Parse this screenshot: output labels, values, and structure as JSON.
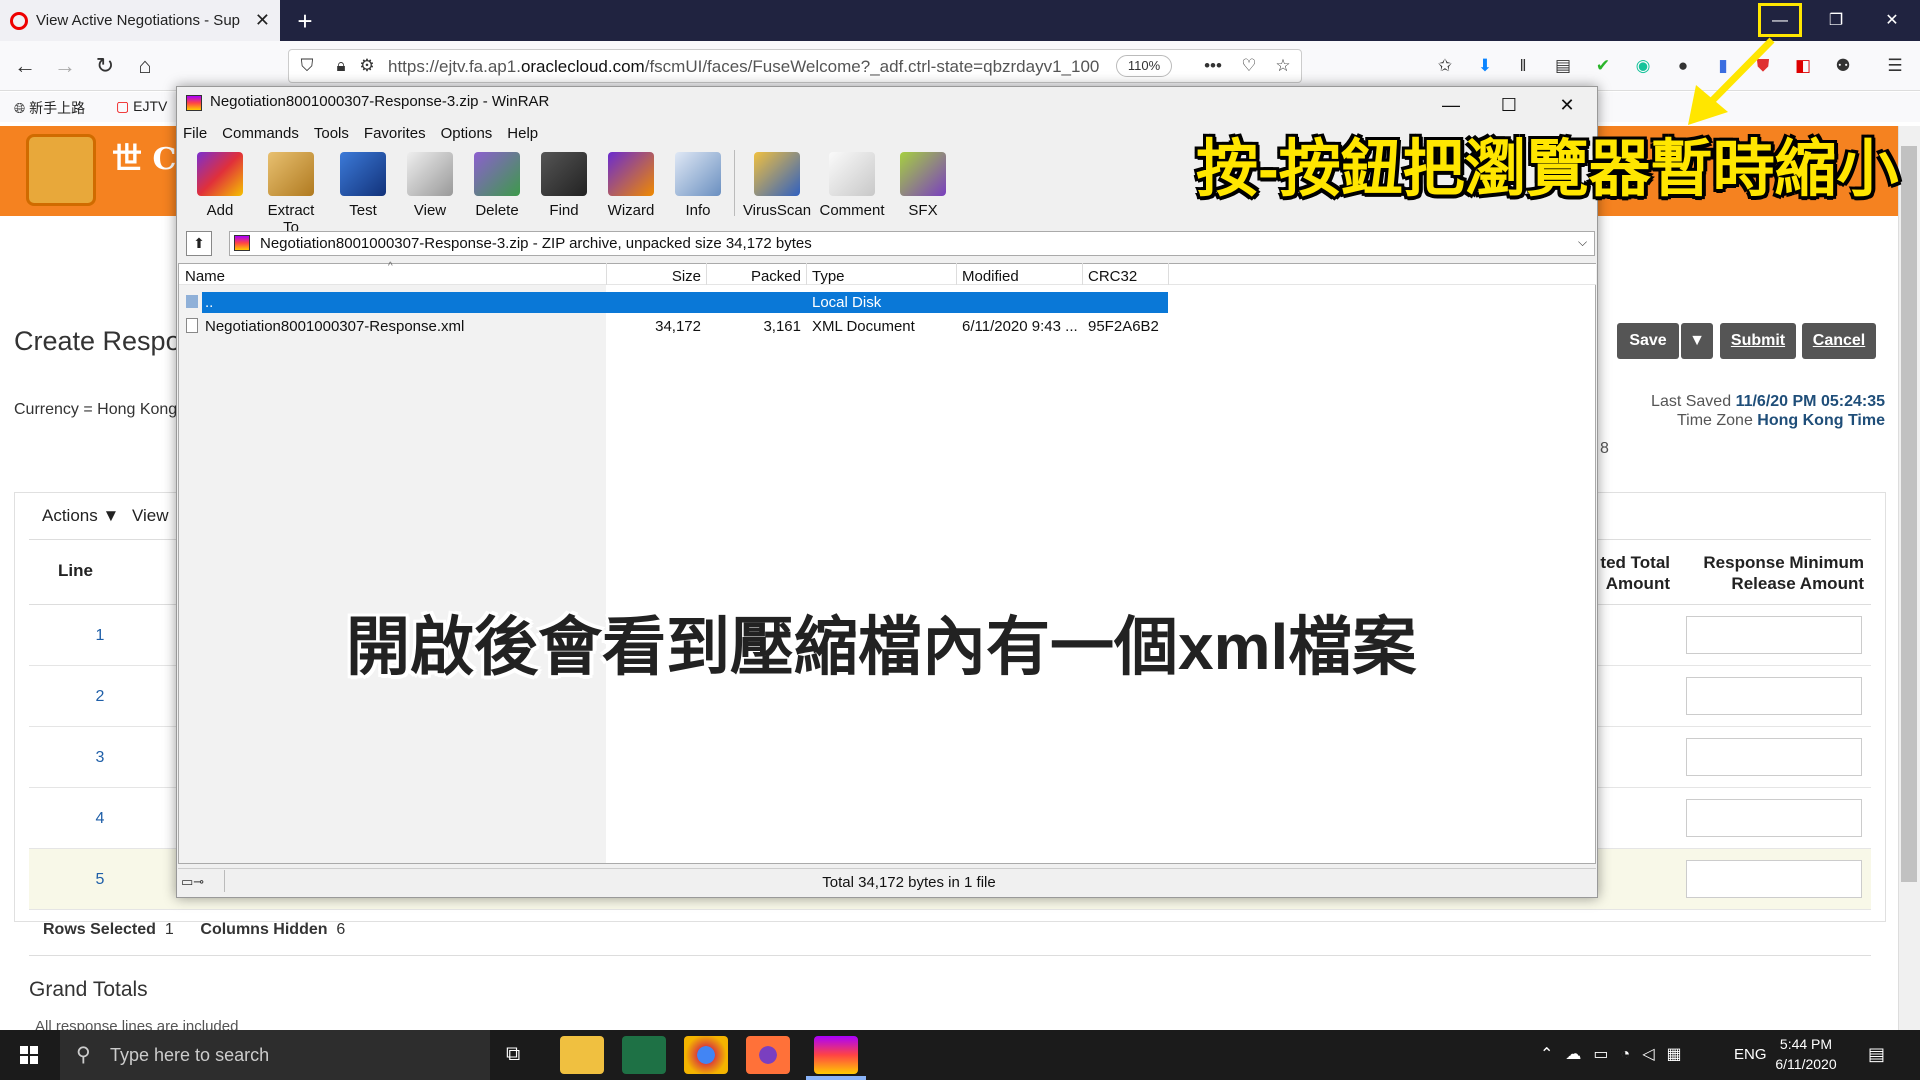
{
  "browser": {
    "tab_title": "View Active Negotiations - Sup",
    "url_prefix": "https://ejtv.fa.ap1.",
    "url_domain": "oraclecloud.com",
    "url_path": "/fscmUI/faces/FuseWelcome?_adf.ctrl-state=qbzrdayv1_100",
    "zoom": "110%",
    "bookmarks": [
      "新手上路",
      "EJTV"
    ]
  },
  "page": {
    "logo_text": "世 Cen",
    "title": "Create Respo",
    "currency": "Currency = Hong Kong",
    "buttons": {
      "save": "Save",
      "submit": "Submit",
      "cancel": "Cancel"
    },
    "last_saved_label": "Last Saved",
    "last_saved_value": "11/6/20 PM 05:24:35",
    "tz_label": "Time Zone",
    "tz_value": "Hong Kong Time",
    "stray_digit": "8",
    "actions_label": "Actions ▼",
    "view_label": "View",
    "line_header": "Line",
    "col_total_l1": "ted Total",
    "col_total_l2": "Amount",
    "col_min_l1": "Response Minimum",
    "col_min_l2": "Release Amount",
    "rows": [
      "1",
      "2",
      "3",
      "4",
      "5"
    ],
    "rows_selected_label": "Rows Selected",
    "rows_selected_value": "1",
    "columns_hidden_label": "Columns Hidden",
    "columns_hidden_value": "6",
    "grand_totals": "Grand Totals",
    "all_response": "All response lines are included"
  },
  "winrar": {
    "title": "Negotiation8001000307-Response-3.zip - WinRAR",
    "menu": [
      "File",
      "Commands",
      "Tools",
      "Favorites",
      "Options",
      "Help"
    ],
    "toolbar": [
      "Add",
      "Extract To",
      "Test",
      "View",
      "Delete",
      "Find",
      "Wizard",
      "Info",
      "VirusScan",
      "Comment",
      "SFX"
    ],
    "path": "Negotiation8001000307-Response-3.zip - ZIP archive, unpacked size 34,172 bytes",
    "columns": [
      "Name",
      "Size",
      "Packed",
      "Type",
      "Modified",
      "CRC32"
    ],
    "parent_row": {
      "name": "..",
      "type": "Local Disk"
    },
    "file_row": {
      "name": "Negotiation8001000307-Response.xml",
      "size": "34,172",
      "packed": "3,161",
      "type": "XML Document",
      "modified": "6/11/2020 9:43 ...",
      "crc": "95F2A6B2"
    },
    "status": "Total 34,172 bytes in 1 file"
  },
  "captions": {
    "top_right": "按-按鈕把瀏覽器暫時縮小",
    "center": "開啟後會看到壓縮檔內有一個xml檔案"
  },
  "taskbar": {
    "search_placeholder": "Type here to search",
    "lang": "ENG",
    "time": "5:44 PM",
    "date": "6/11/2020"
  },
  "colors": {
    "oracle_orange": "#f58220",
    "selection_blue": "#0a78d7",
    "caption_yellow": "#ffe600",
    "button_gray": "#555555"
  }
}
